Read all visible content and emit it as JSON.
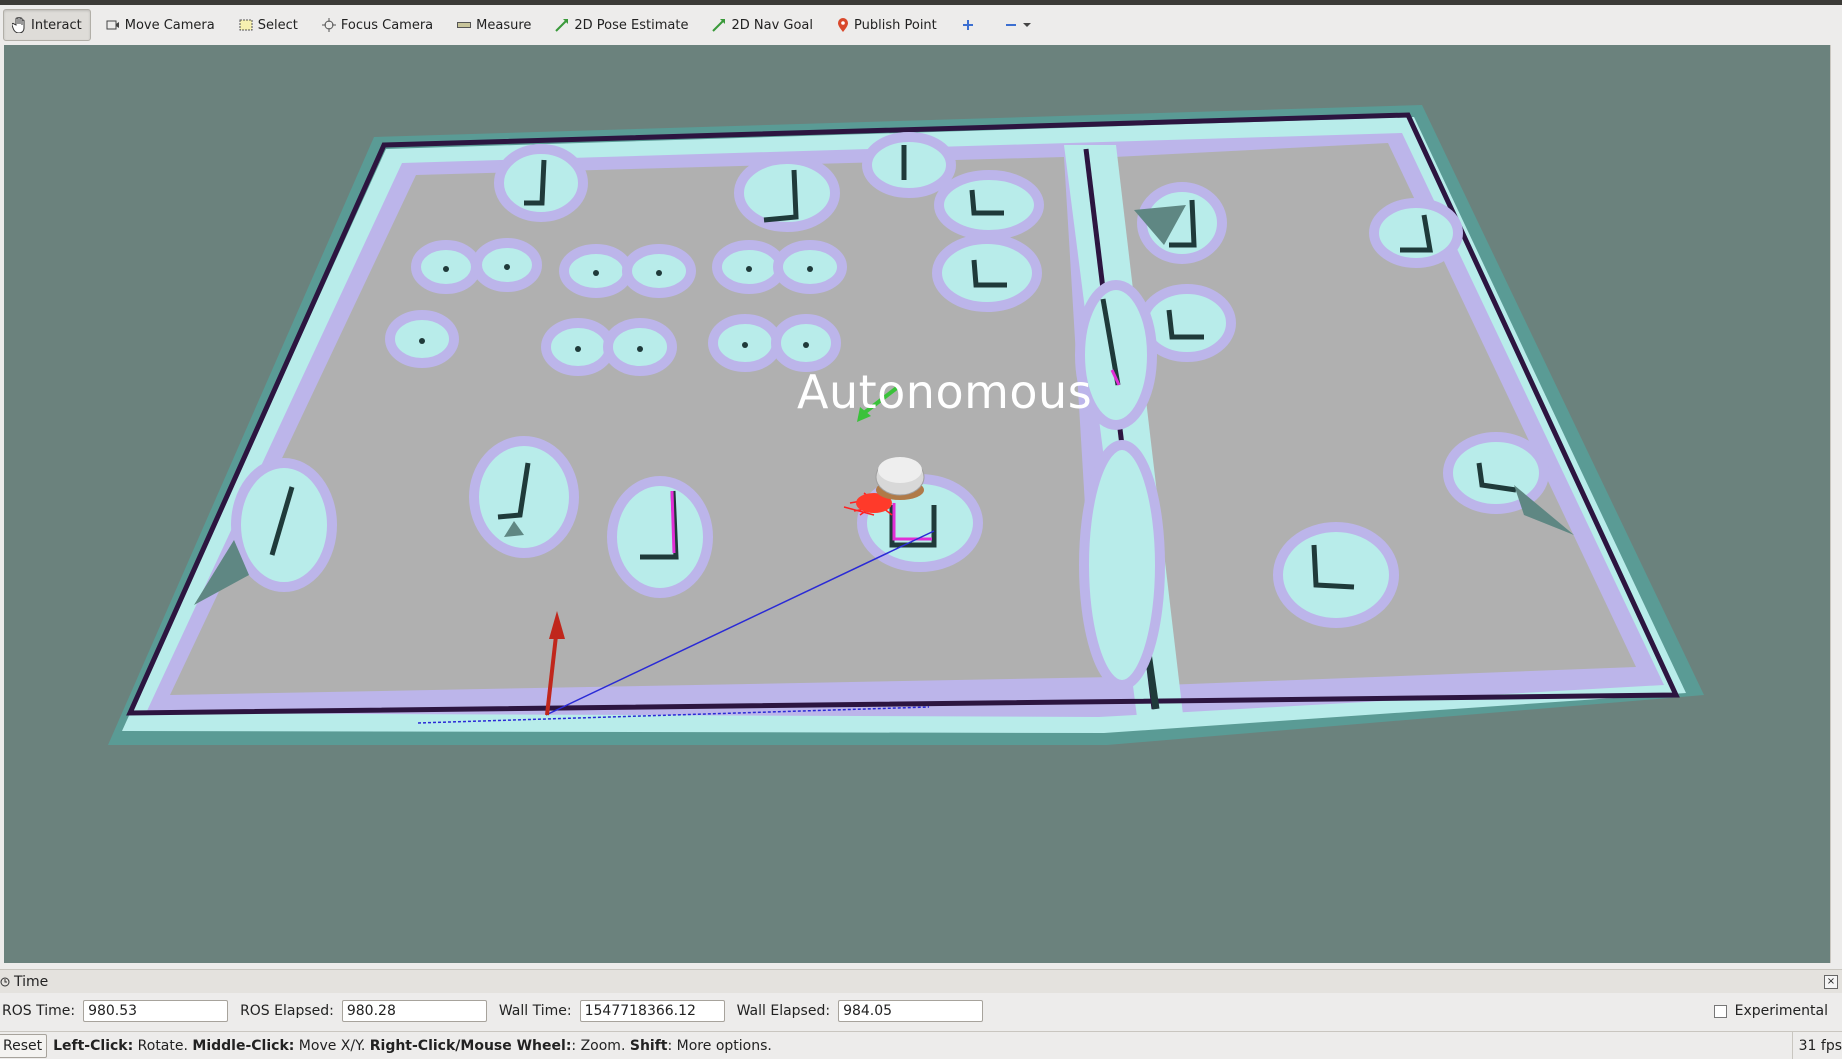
{
  "toolbar": {
    "interact": "Interact",
    "move_camera": "Move Camera",
    "select": "Select",
    "focus_camera": "Focus Camera",
    "measure": "Measure",
    "pose_estimate": "2D Pose Estimate",
    "nav_goal": "2D Nav Goal",
    "publish_point": "Publish Point"
  },
  "viewport": {
    "overlay_text": "Autonomous",
    "background_color": "#6b827d"
  },
  "time_panel": {
    "title": "Time",
    "ros_time_label": "ROS Time:",
    "ros_time": "980.53",
    "ros_elapsed_label": "ROS Elapsed:",
    "ros_elapsed": "980.28",
    "wall_time_label": "Wall Time:",
    "wall_time": "1547718366.12",
    "wall_elapsed_label": "Wall Elapsed:",
    "wall_elapsed": "984.05",
    "experimental_label": "Experimental"
  },
  "status": {
    "reset": "Reset",
    "hint_left_key": "Left-Click:",
    "hint_left": " Rotate. ",
    "hint_mid_key": "Middle-Click:",
    "hint_mid": " Move X/Y. ",
    "hint_right_key": "Right-Click/Mouse Wheel:",
    "hint_right": ": Zoom. ",
    "hint_shift_key": "Shift",
    "hint_shift": ": More options.",
    "fps": "31 fps"
  }
}
